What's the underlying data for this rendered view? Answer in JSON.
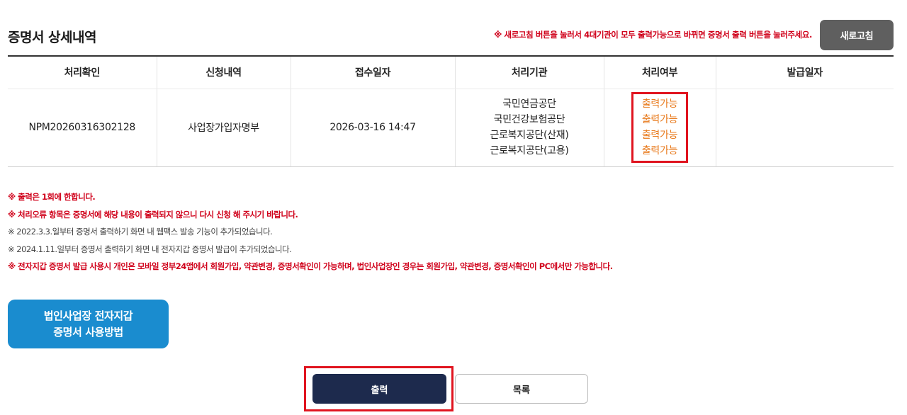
{
  "page": {
    "title": "증명서 상세내역",
    "refresh_notice": "※ 새로고침 버튼을 눌러서 4대기관이 모두 출력가능으로 바뀌면 증명서 출력 버튼을 눌러주세요.",
    "refresh_button": "새로고침"
  },
  "table": {
    "headers": [
      "처리확인",
      "신청내역",
      "접수일자",
      "처리기관",
      "처리여부",
      "발급일자"
    ],
    "row": {
      "confirm_no": "NPM20260316302128",
      "application": "사업장가입자명부",
      "received_at": "2026-03-16 14:47",
      "agencies": [
        "국민연금공단",
        "국민건강보험공단",
        "근로복지공단(산재)",
        "근로복지공단(고용)"
      ],
      "statuses": [
        "출력가능",
        "출력가능",
        "출력가능",
        "출력가능"
      ],
      "issued_at": ""
    }
  },
  "notes": [
    {
      "text": "※ 출력은 1회에 한합니다.",
      "style": "red"
    },
    {
      "text": "※ 처리오류 항목은 증명서에 해당 내용이 출력되지 않으니 다시 신청 해 주시기 바랍니다.",
      "style": "red"
    },
    {
      "text": "※ 2022.3.3.일부터 증명서 출력하기 화면 내 웹팩스 발송 기능이 추가되었습니다.",
      "style": "gray"
    },
    {
      "text": "※ 2024.1.11.일부터 증명서 출력하기 화면 내 전자지갑 증명서 발급이 추가되었습니다.",
      "style": "gray"
    },
    {
      "text": "※ 전자지갑 증명서 발급 사용시 개인은 모바일 정부24앱에서 회원가입, 약관변경, 증명서확인이 가능하며, 법인사업장인 경우는 회원가입, 약관변경, 증명서확인이 PC에서만 가능합니다.",
      "style": "red"
    }
  ],
  "guide_button": {
    "line1": "법인사업장 전자지갑",
    "line2": "증명서 사용방법"
  },
  "actions": {
    "print": "출력",
    "list": "목록"
  },
  "colors": {
    "notice_red": "#d0021b",
    "status_orange": "#e87a1c",
    "highlight_red": "#e0141f",
    "guide_blue": "#1a8ccf",
    "print_navy": "#1d2a4d",
    "refresh_gray": "#5f5f5f"
  }
}
